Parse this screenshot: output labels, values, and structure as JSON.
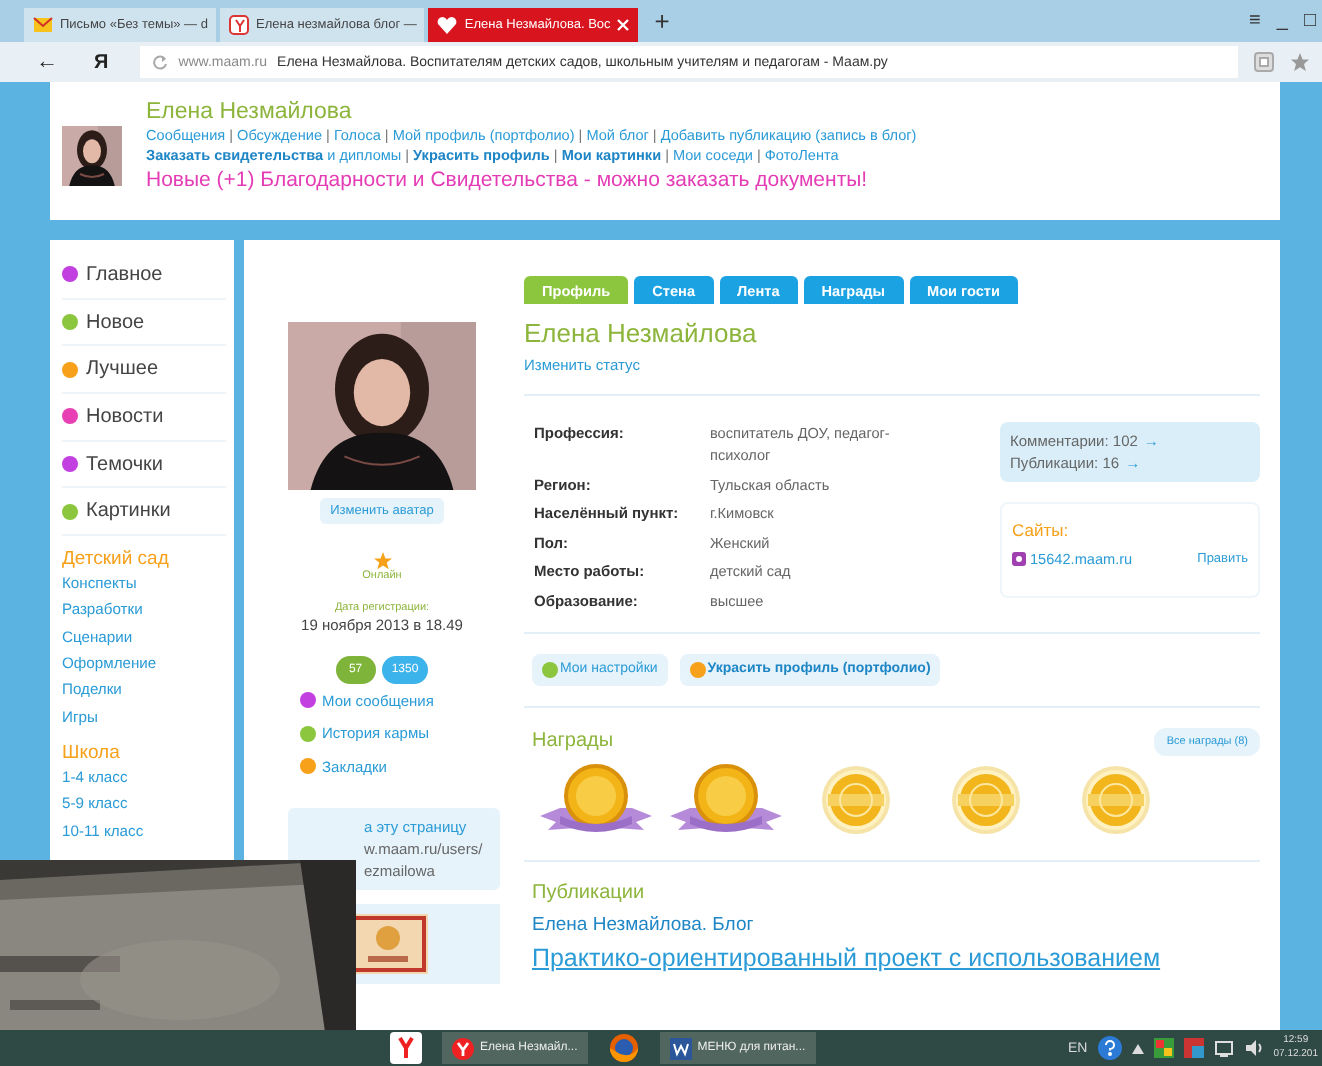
{
  "browser": {
    "tabs": [
      {
        "title": "Письмо «Без темы» — d",
        "selected": false
      },
      {
        "title": "Елена незмайлова блог —",
        "selected": false
      },
      {
        "title": "Елена Незмайлова. Вос",
        "selected": true
      }
    ],
    "new_tab": "+",
    "window_controls": [
      "≡",
      "_",
      "□"
    ],
    "address": {
      "back": "←",
      "logo": "Я",
      "domain": "www.maam.ru",
      "page_title": "Елена Незмайлова. Воспитателям детских садов, школьным учителям и педагогам - Маам.ру"
    }
  },
  "header": {
    "name": "Елена Незмайлова",
    "separator": "|",
    "links": [
      "Сообщения",
      "Обсуждение",
      "Голоса",
      "Мой профиль (портфолио)",
      "Мой блог",
      "Добавить публикацию (запись в блог)"
    ],
    "links_2": [
      "**Заказать свидетельства** и дипломы",
      "**Украсить профиль**",
      "**Мои картинки**",
      "Мои соседи",
      "ФотоЛента"
    ],
    "notice": "Новые (+1) Благодарности и Свидетельства - можно заказать документы!"
  },
  "sidebar": {
    "items": [
      {
        "label": "Главное",
        "color": "#c23fe0"
      },
      {
        "label": "Новое",
        "color": "#8cc63f"
      },
      {
        "label": "Лучшее",
        "color": "#f7a01a"
      },
      {
        "label": "Новости",
        "color": "#e840b4"
      },
      {
        "label": "Темочки",
        "color": "#c23fe0"
      },
      {
        "label": "Картинки",
        "color": "#8cc63f"
      }
    ],
    "sections": [
      {
        "title": "Детский сад",
        "items": [
          "Конспекты",
          "Разработки",
          "Сценарии",
          "Оформление",
          "Поделки",
          "Игры"
        ]
      },
      {
        "title": "Школа",
        "items": [
          "1-4 класс",
          "5-9 класс",
          "10-11 класс"
        ]
      }
    ]
  },
  "profile": {
    "avatar": {
      "kind": "picture"
    },
    "avatar_button": "Изменить аватар",
    "status": "Онлайн",
    "reg_label": "Дата регистрации:",
    "reg_date": "19 ноября 2013 в 18.49",
    "badges": [
      {
        "text": "57",
        "color": "#7fb43a"
      },
      {
        "text": "1350",
        "color": "#3cb3ea"
      }
    ],
    "links": [
      {
        "label": "Мои сообщения",
        "color": "#c23fe0"
      },
      {
        "label": "История кармы",
        "color": "#8cc63f"
      },
      {
        "label": "Закладки",
        "color": "#f7a01a"
      }
    ],
    "share_lines": [
      "а эту страницу",
      "w.maam.ru/users/",
      "ezmailowa"
    ]
  },
  "tabs": [
    {
      "label": "Профиль",
      "selected": true
    },
    {
      "label": "Стена",
      "selected": false
    },
    {
      "label": "Лента",
      "selected": false
    },
    {
      "label": "Награды",
      "selected": false
    },
    {
      "label": "Мои гости",
      "selected": false
    }
  ],
  "name": "Елена Незмайлова",
  "change_status": "Изменить статус",
  "fields": [
    {
      "label": "Профессия:",
      "value": "воспитатель ДОУ, педагог-психолог"
    },
    {
      "label": "Регион:",
      "value": "Тульская область"
    },
    {
      "label": "Населённый пункт:",
      "value": "г.Кимовск"
    },
    {
      "label": "Пол:",
      "value": "Женский"
    },
    {
      "label": "Место работы:",
      "value": "детский сад"
    },
    {
      "label": "Образование:",
      "value": "высшее"
    }
  ],
  "stats": [
    {
      "label": "Комментарии: 102",
      "arrow": "→"
    },
    {
      "label": "Публикации: 16",
      "arrow": "→"
    }
  ],
  "sites": {
    "title": "Сайты:",
    "url": "15642.maam.ru",
    "edit": "Править"
  },
  "actions": [
    {
      "label": "Мои настройки",
      "color": "#8cc63f",
      "bold": false
    },
    {
      "label": "Украсить профиль (портфолио)",
      "color": "#f7a01a",
      "bold": true
    }
  ],
  "awards": {
    "title": "Награды",
    "all_link": "Все награды (8)",
    "items": [
      {
        "kind": "medal"
      },
      {
        "kind": "medal"
      },
      {
        "kind": "seal"
      },
      {
        "kind": "seal"
      },
      {
        "kind": "seal"
      }
    ]
  },
  "publications": {
    "title": "Публикации",
    "blog": "Елена Незмайлова. Блог",
    "post": "Практико-ориентированный проект с использованием"
  },
  "overlay_photo": {
    "kind": "picture"
  },
  "taskbar": {
    "items": [
      {
        "kind": "yandex"
      },
      {
        "kind": "browser",
        "label": "Елена Незмайл..."
      },
      {
        "kind": "firefox"
      },
      {
        "kind": "word",
        "label": "МЕНЮ для питан..."
      }
    ],
    "lang": "EN",
    "time": "12:59",
    "date": "07.12.201"
  }
}
